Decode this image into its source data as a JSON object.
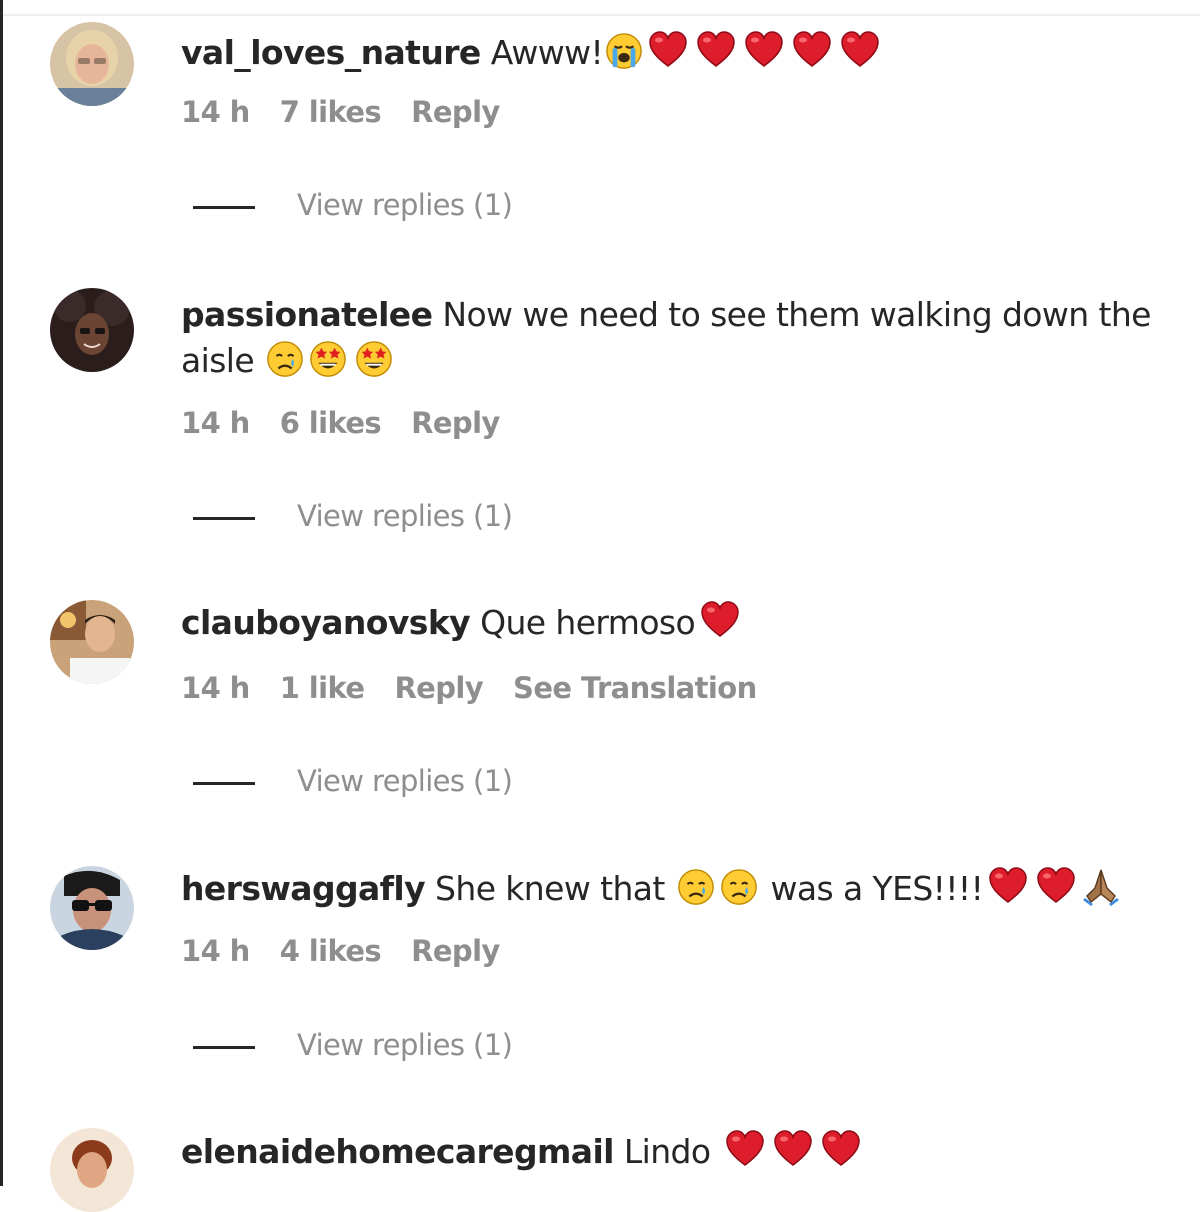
{
  "comments": [
    {
      "username": "val_loves_nature",
      "text": "Awww!",
      "emoji": [
        "loudly-crying-face",
        "red-heart",
        "red-heart",
        "red-heart",
        "red-heart",
        "red-heart"
      ],
      "time": "14 h",
      "likes": "7 likes",
      "reply_label": "Reply",
      "view_replies": "View replies (1)"
    },
    {
      "username": "passionatelee",
      "text": "Now we need to see them walking down the aisle",
      "emoji": [
        "crying-face",
        "star-struck-face",
        "star-struck-face"
      ],
      "time": "14 h",
      "likes": "6 likes",
      "reply_label": "Reply",
      "view_replies": "View replies (1)"
    },
    {
      "username": "clauboyanovsky",
      "text": "Que hermoso",
      "emoji": [
        "red-heart"
      ],
      "time": "14 h",
      "likes": "1 like",
      "reply_label": "Reply",
      "translate_label": "See Translation",
      "view_replies": "View replies (1)"
    },
    {
      "username": "herswaggafly",
      "text_before": "She knew that",
      "emoji_mid": [
        "crying-face",
        "crying-face"
      ],
      "text_after": "was a YES!!!!",
      "emoji": [
        "red-heart",
        "red-heart",
        "folded-hands"
      ],
      "time": "14 h",
      "likes": "4 likes",
      "reply_label": "Reply",
      "view_replies": "View replies (1)"
    },
    {
      "username": "elenaidehomecaregmail",
      "text": "Lindo",
      "emoji": [
        "red-heart",
        "red-heart",
        "red-heart"
      ]
    }
  ],
  "colors": {
    "text_primary": "#262626",
    "text_secondary": "#8e8e8e",
    "heart": "#e0112b",
    "emoji_face": "#ffcc33"
  }
}
